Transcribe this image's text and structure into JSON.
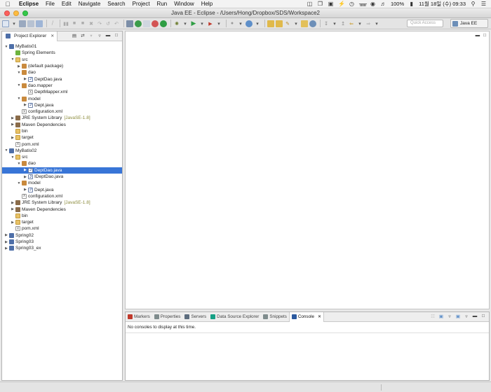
{
  "menubar": {
    "app": "Eclipse",
    "items": [
      "File",
      "Edit",
      "Navigate",
      "Search",
      "Project",
      "Run",
      "Window",
      "Help"
    ],
    "battery": "100%",
    "clock": "11월 18일 (수)  09:33"
  },
  "window": {
    "title": "Java EE - Eclipse - /Users/Hong/Dropbox/SDS/Workspace2"
  },
  "toolbar": {
    "quick_access_placeholder": "Quick Access",
    "perspective": "Java EE"
  },
  "explorer": {
    "tab_label": "Project Explorer",
    "tree": [
      {
        "label": "MyBatis01",
        "depth": 0,
        "icon": "project",
        "expanded": true
      },
      {
        "label": "Spring Elements",
        "depth": 1,
        "icon": "spring",
        "expanded": null
      },
      {
        "label": "src",
        "depth": 1,
        "icon": "folder",
        "expanded": true
      },
      {
        "label": "(default package)",
        "depth": 2,
        "icon": "package",
        "expanded": false
      },
      {
        "label": "dao",
        "depth": 2,
        "icon": "package",
        "expanded": true
      },
      {
        "label": "DeptDao.java",
        "depth": 3,
        "icon": "java",
        "expanded": false
      },
      {
        "label": "dao.mapper",
        "depth": 2,
        "icon": "package",
        "expanded": true
      },
      {
        "label": "DeptMapper.xml",
        "depth": 3,
        "icon": "xml",
        "expanded": null
      },
      {
        "label": "model",
        "depth": 2,
        "icon": "package",
        "expanded": true
      },
      {
        "label": "Dept.java",
        "depth": 3,
        "icon": "java",
        "expanded": false
      },
      {
        "label": "configuration.xml",
        "depth": 2,
        "icon": "xml",
        "expanded": null
      },
      {
        "label": "JRE System Library",
        "suffix": "[JavaSE-1.8]",
        "depth": 1,
        "icon": "lib",
        "expanded": false
      },
      {
        "label": "Maven Dependencies",
        "depth": 1,
        "icon": "lib",
        "expanded": false
      },
      {
        "label": "bin",
        "depth": 1,
        "icon": "folder",
        "expanded": null
      },
      {
        "label": "target",
        "depth": 1,
        "icon": "folder",
        "expanded": false
      },
      {
        "label": "pom.xml",
        "depth": 1,
        "icon": "xml",
        "expanded": null
      },
      {
        "label": "MyBatis02",
        "depth": 0,
        "icon": "project",
        "expanded": true
      },
      {
        "label": "src",
        "depth": 1,
        "icon": "folder",
        "expanded": true
      },
      {
        "label": "dao",
        "depth": 2,
        "icon": "package",
        "expanded": true
      },
      {
        "label": "DeptDao.java",
        "depth": 3,
        "icon": "java",
        "expanded": false,
        "selected": true
      },
      {
        "label": "IDeptDao.java",
        "depth": 3,
        "icon": "java",
        "expanded": false
      },
      {
        "label": "model",
        "depth": 2,
        "icon": "package",
        "expanded": true
      },
      {
        "label": "Dept.java",
        "depth": 3,
        "icon": "java",
        "expanded": false
      },
      {
        "label": "configuration.xml",
        "depth": 2,
        "icon": "xml",
        "expanded": null
      },
      {
        "label": "JRE System Library",
        "suffix": "[JavaSE-1.8]",
        "depth": 1,
        "icon": "lib",
        "expanded": false
      },
      {
        "label": "Maven Dependencies",
        "depth": 1,
        "icon": "lib",
        "expanded": false
      },
      {
        "label": "bin",
        "depth": 1,
        "icon": "folder",
        "expanded": null
      },
      {
        "label": "target",
        "depth": 1,
        "icon": "folder",
        "expanded": false
      },
      {
        "label": "pom.xml",
        "depth": 1,
        "icon": "xml",
        "expanded": null
      },
      {
        "label": "Spring02",
        "depth": 0,
        "icon": "project",
        "expanded": false
      },
      {
        "label": "Spring03",
        "depth": 0,
        "icon": "project",
        "expanded": false
      },
      {
        "label": "Spring03_ex",
        "depth": 0,
        "icon": "project",
        "expanded": false
      }
    ]
  },
  "bottom_panel": {
    "tabs": [
      {
        "label": "Markers",
        "color": "#c0392b"
      },
      {
        "label": "Properties",
        "color": "#7f8c8d"
      },
      {
        "label": "Servers",
        "color": "#5d6d7e"
      },
      {
        "label": "Data Source Explorer",
        "color": "#16a085"
      },
      {
        "label": "Snippets",
        "color": "#7f8c8d"
      },
      {
        "label": "Console",
        "color": "#2c5aa0",
        "active": true
      }
    ],
    "console_message": "No consoles to display at this time."
  },
  "colors": {
    "selection": "#3875d7"
  }
}
